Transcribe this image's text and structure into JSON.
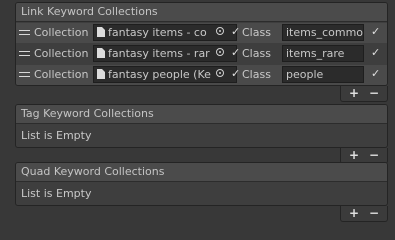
{
  "link_panel": {
    "title": "Link Keyword Collections",
    "rows": [
      {
        "collection_label": "Collection",
        "collection_value": "fantasy items - co",
        "class_label": "Class",
        "class_value": "items_common"
      },
      {
        "collection_label": "Collection",
        "collection_value": "fantasy items - rar",
        "class_label": "Class",
        "class_value": "items_rare"
      },
      {
        "collection_label": "Collection",
        "collection_value": "fantasy people (Ke",
        "class_label": "Class",
        "class_value": "people"
      }
    ]
  },
  "tag_panel": {
    "title": "Tag Keyword Collections",
    "empty_text": "List is Empty"
  },
  "quad_panel": {
    "title": "Quad Keyword Collections",
    "empty_text": "List is Empty"
  },
  "footer": {
    "add_label": "+",
    "remove_label": "−"
  },
  "icons": {
    "checkmark": "✓"
  }
}
